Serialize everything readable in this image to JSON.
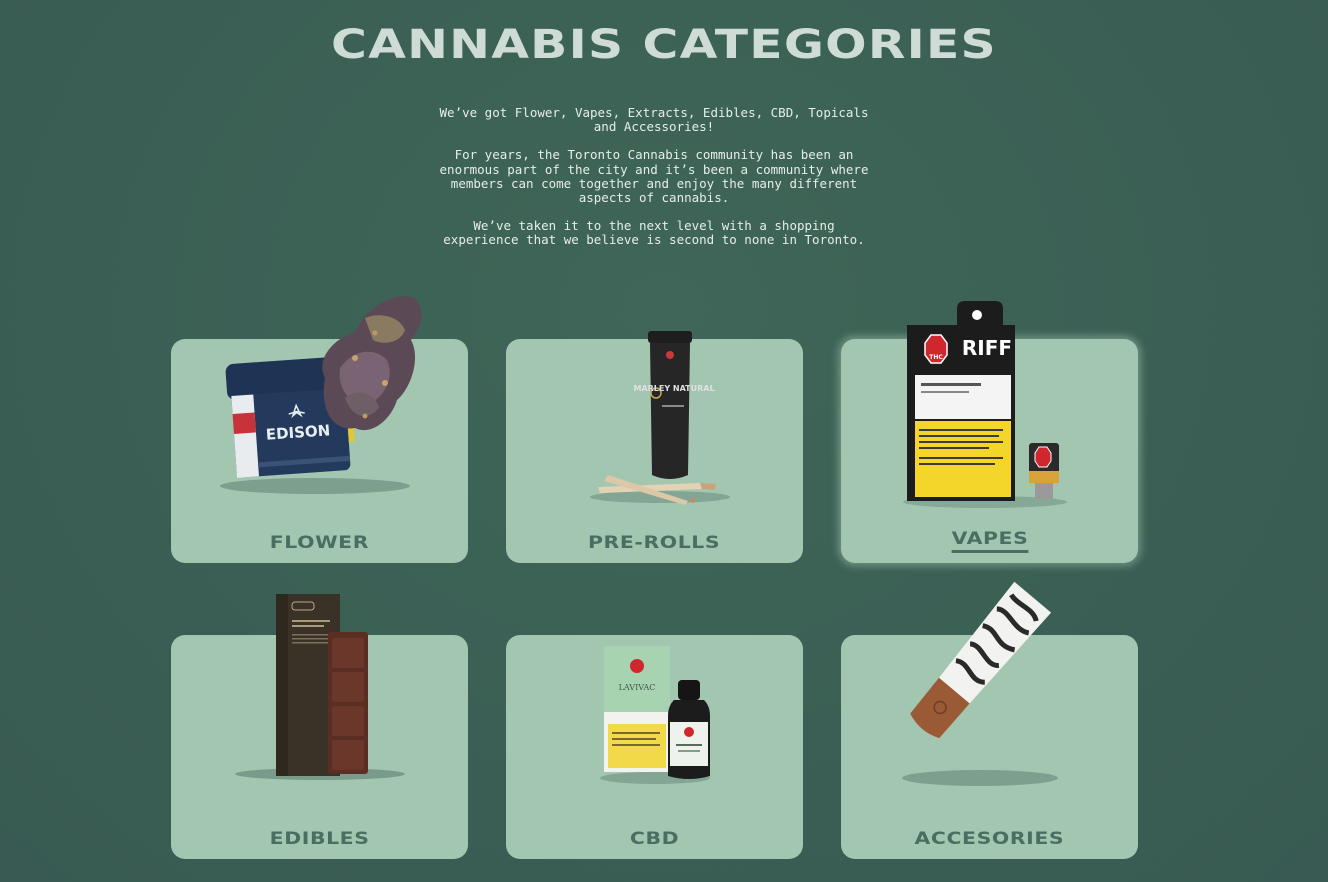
{
  "page": {
    "title": "CANNABIS CATEGORIES",
    "intro": [
      "We’ve got Flower, Vapes, Extracts, Edibles, CBD, Topicals and Accessories!",
      "For years, the Toronto Cannabis community has been an enormous part of the city and it’s been a community where members can come together and enjoy the many different aspects of cannabis.",
      "We’ve taken it to the next level with a shopping experience that we believe is second to none in Toronto."
    ]
  },
  "categories": [
    {
      "label": "FLOWER",
      "icon": "flower-jar-image",
      "state": "default"
    },
    {
      "label": "PRE-ROLLS",
      "icon": "pre-roll-tube-image",
      "state": "default"
    },
    {
      "label": "VAPES",
      "icon": "vape-cartridge-box-image",
      "state": "hovered"
    },
    {
      "label": "EDIBLES",
      "icon": "chocolate-bar-image",
      "state": "default"
    },
    {
      "label": "CBD",
      "icon": "cbd-oil-bottle-image",
      "state": "default"
    },
    {
      "label": "ACCESORIES",
      "icon": "rolling-paper-cone-image",
      "state": "default"
    }
  ],
  "product_text": {
    "flower_brand": "EDISON",
    "preroll_brand": "MARLEY NATURAL",
    "vape_brand": "RIFF",
    "thc_badge": "THC",
    "cbd_brand": "LAVIVAC"
  },
  "colors": {
    "background": "#3b5f54",
    "card": "#a3c6b1",
    "card_label": "#4a6e61",
    "title": "#cfdcd6",
    "intro_text": "#e6eee9"
  }
}
